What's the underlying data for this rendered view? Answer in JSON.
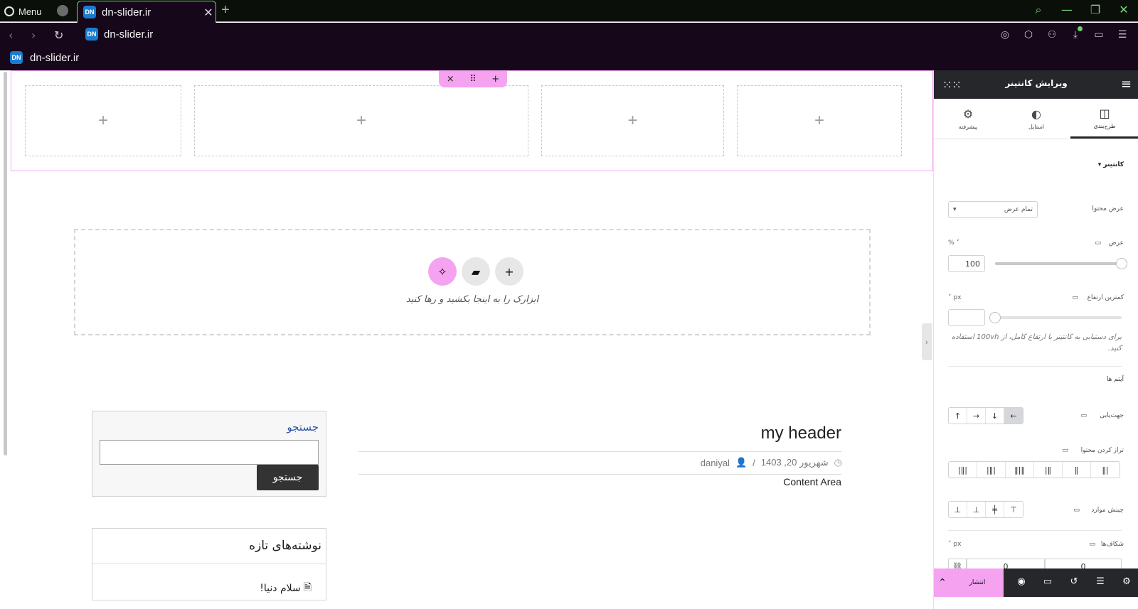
{
  "browser": {
    "menu_label": "Menu",
    "tab_title": "dn-slider.ir",
    "favicon_text": "DN",
    "address": "dn-slider.ir",
    "bookmark": "dn-slider.ir",
    "accent_color": "#6bd36b"
  },
  "canvas": {
    "container_toolbar": {
      "close": "×",
      "drag": "⠿",
      "add": "+"
    },
    "column_add": "+",
    "dropzone": {
      "add_icon": "plus-icon",
      "template_icon": "folder-icon",
      "ai_icon": "sparkle-icon",
      "text": "ابزارک را به اینجا بکشید و رها کنید"
    },
    "search_widget": {
      "title": "جستجو",
      "input_value": "",
      "button": "جستجو"
    },
    "recent_posts": {
      "title": "نوشته‌های تازه",
      "item": "سلام دنیا!"
    },
    "post": {
      "title": "my header",
      "date": "شهریور 20, 1403",
      "author": "daniyal",
      "separator": "/",
      "content": "Content Area"
    }
  },
  "panel": {
    "title": "ویرایش کانتینر",
    "tabs": [
      {
        "label": "طرح‌بندی",
        "icon": "layout-icon",
        "active": true
      },
      {
        "label": "استایل",
        "icon": "contrast-icon",
        "active": false
      },
      {
        "label": "پیشرفته",
        "icon": "gear-icon",
        "active": false
      }
    ],
    "section_title": "کانتینر",
    "content_width": {
      "label": "عرض محتوا",
      "value": "تمام عرض"
    },
    "width": {
      "label": "عرض",
      "unit": "%",
      "value": "100",
      "slider": 1.0
    },
    "min_height": {
      "label": "کمترین ارتفاع",
      "unit": "px",
      "value": "",
      "slider": 0.0
    },
    "help_text": "برای دستیابی به کانتینر با ارتفاع کامل، از 100vh استفاده کنید.",
    "items_title": "آیتم ها",
    "direction": {
      "label": "جهت‌یابی",
      "buttons": [
        "↑",
        "→",
        "↓",
        "←"
      ],
      "selected": 3
    },
    "justify": {
      "label": "تراز کردن محتوا"
    },
    "align": {
      "label": "چینش موارد"
    },
    "gaps": {
      "label": "شکاف‌ها",
      "unit": "px",
      "column": "0",
      "row": "0"
    },
    "footer": {
      "publish": "انتشار"
    }
  }
}
